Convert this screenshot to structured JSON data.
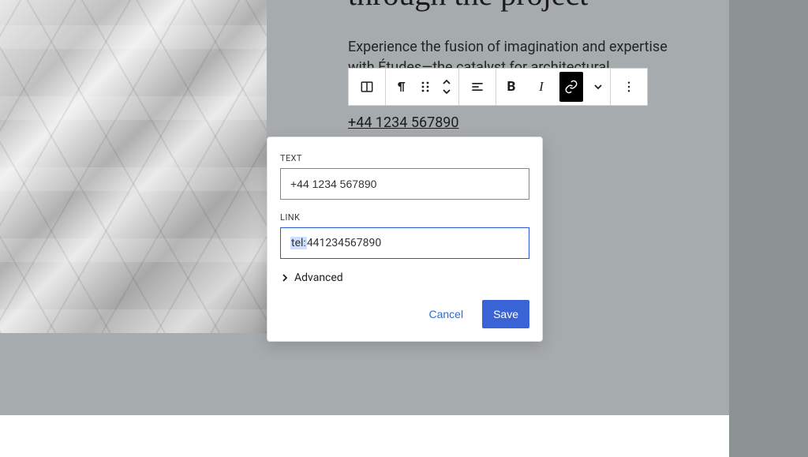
{
  "headline": "through the project",
  "body_text": "Experience the fusion of imagination and expertise with Études—the catalyst for architectural",
  "phone_display": "+44 1234 567890",
  "toolbar": {
    "transform_icon": "columns-icon",
    "paragraph_icon": "pilcrow-icon",
    "drag_icon": "drag-handle-icon",
    "move_icon": "chevrons-vertical-icon",
    "align_icon": "align-left-icon",
    "bold_glyph": "B",
    "italic_glyph": "I",
    "link_icon": "link-icon",
    "chevron_icon": "chevron-down-icon",
    "more_icon": "more-vertical-icon"
  },
  "dialog": {
    "text_label": "TEXT",
    "text_value": "+44 1234 567890",
    "link_label": "LINK",
    "link_prefix": "tel:",
    "link_rest": "441234567890",
    "advanced_label": "Advanced",
    "cancel_label": "Cancel",
    "save_label": "Save"
  }
}
